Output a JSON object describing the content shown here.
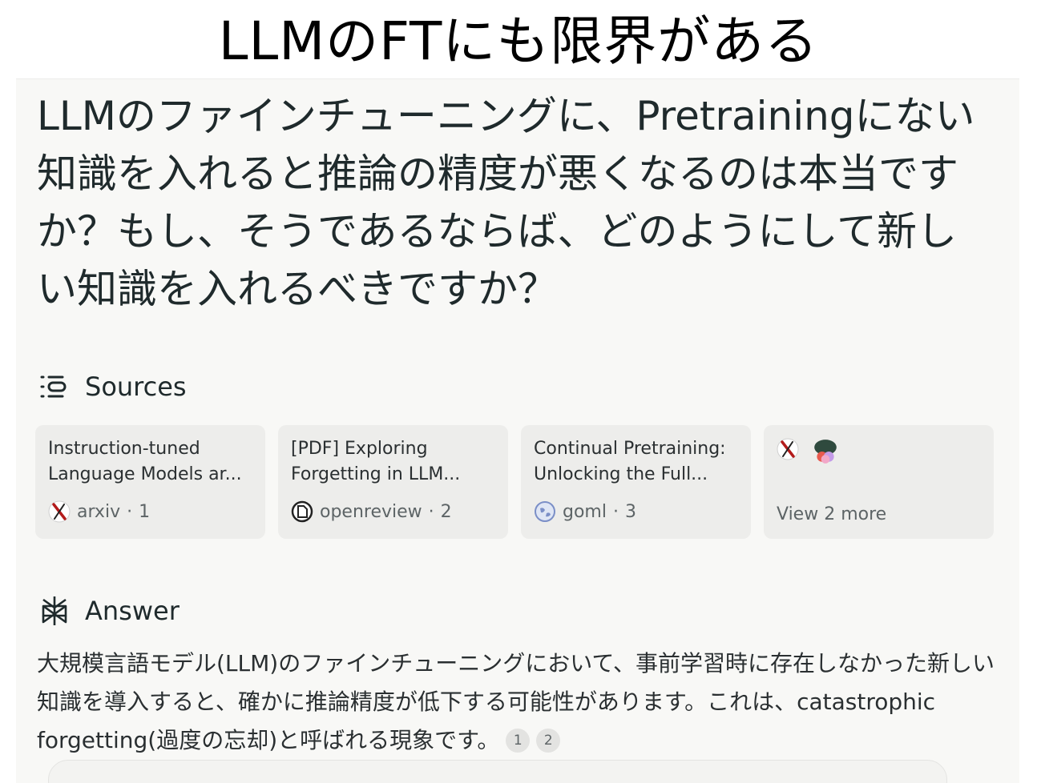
{
  "slide_title": "LLMのFTにも限界がある",
  "question": "LLMのファインチューニングに、Pretrainingにない知識を入れると推論の精度が悪くなるのは本当ですか？もし、そうであるならば、どのようにして新しい知識を入れるべきですか？",
  "sources": {
    "heading": "Sources",
    "icon": "sources-icon",
    "cards": [
      {
        "title_line1": "Instruction-tuned",
        "title_line2": "Language Models ar...",
        "site": "arxiv",
        "index": "1",
        "icon": "arxiv-favicon-icon"
      },
      {
        "title_line1": "[PDF] Exploring",
        "title_line2": "Forgetting in LLM...",
        "site": "openreview",
        "index": "2",
        "icon": "openreview-favicon-icon"
      },
      {
        "title_line1": "Continual Pretraining:",
        "title_line2": "Unlocking the Full...",
        "site": "goml",
        "index": "3",
        "icon": "globe-favicon-icon"
      }
    ],
    "more": {
      "label": "View 2 more",
      "icons": [
        "arxiv-favicon-icon",
        "blob-favicon-icon"
      ]
    }
  },
  "answer": {
    "heading": "Answer",
    "icon": "perplexity-logo-icon",
    "text": "大規模言語モデル(LLM)のファインチューニングにおいて、事前学習時に存在しなかった新しい知識を導入すると、確かに推論精度が低下する可能性があります。これは、catastrophic forgetting(過度の忘却)と呼ばれる現象です。",
    "citations": [
      "1",
      "2"
    ]
  },
  "colors": {
    "background": "#f8f8f6",
    "card": "#ededeb",
    "text": "#1f2a2c",
    "muted": "#5d6466"
  }
}
